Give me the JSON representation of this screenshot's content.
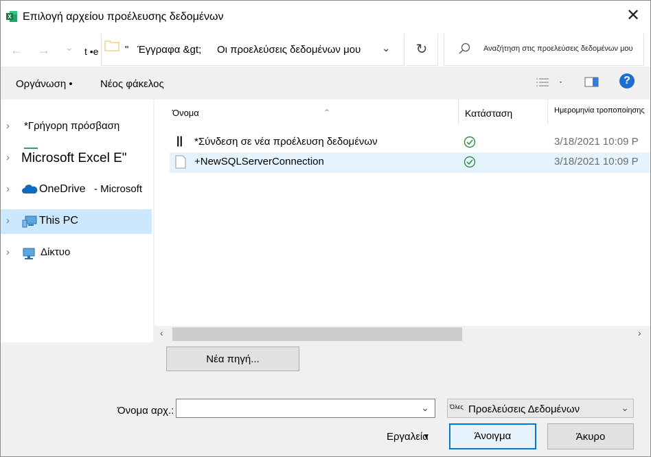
{
  "window": {
    "title": "Επιλογή αρχείου προέλευσης δεδομένων"
  },
  "nav": {
    "back": "←",
    "forward": "→",
    "recent": "⌄",
    "up_prefix": "t •e"
  },
  "address": {
    "quote": "\"",
    "part1": "Έγγραφα &gt;",
    "part2": "Οι προελεύσεις δεδομένων μου"
  },
  "search": {
    "placeholder": "Αναζήτηση στις προελεύσεις δεδομένων μου"
  },
  "toolbar": {
    "organize": "Οργάνωση •",
    "new_folder": "Νέος φάκελος"
  },
  "sidebar": {
    "items": [
      {
        "label": "*Γρήγορη πρόσβαση"
      },
      {
        "label": "Microsoft Excel E\""
      },
      {
        "label": "OneDrive",
        "suffix": "- Microsoft"
      },
      {
        "label": "This PC"
      },
      {
        "label": "Δίκτυο"
      }
    ]
  },
  "columns": {
    "name": "Όνομα",
    "status": "Κατάσταση",
    "date": "Ημερομηνία τροποποίησης"
  },
  "files": [
    {
      "name": "*Σύνδεση σε νέα προέλευση δεδομένων",
      "date": "3/18/2021 10:09 P"
    },
    {
      "name": "+NewSQLServerConnection",
      "date": "3/18/2021 10:09 P"
    }
  ],
  "buttons": {
    "new_source": "Νέα πηγή...",
    "open": "Άνοιγμα",
    "cancel": "Άκυρο",
    "tools": "Εργαλεία"
  },
  "filename": {
    "label": "Όνομα αρχ.:",
    "value": ""
  },
  "filter": {
    "prefix": "Όλες",
    "value": "Προελεύσεις Δεδομένων"
  },
  "colors": {
    "accent": "#0078d7",
    "selection": "#cce8ff",
    "ok": "#2e8b3a",
    "excel": "#1d6f42"
  }
}
